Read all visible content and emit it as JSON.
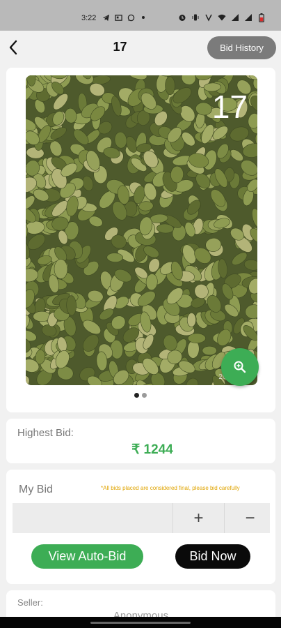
{
  "status_bar": {
    "time": "3:22",
    "left_icons": [
      "telegram-icon",
      "news-icon",
      "whatsapp-icon",
      "dot-icon"
    ],
    "right_icons": [
      "alarm-icon",
      "vibrate-icon",
      "volte-icon",
      "wifi-icon",
      "signal-icon",
      "signal-icon",
      "battery-icon"
    ]
  },
  "header": {
    "title": "17",
    "bid_history_label": "Bid History"
  },
  "product": {
    "lot_overlay": "17",
    "date_watermark": "2021-3-23",
    "image_count": 2,
    "active_image": 1
  },
  "highest_bid": {
    "label": "Highest Bid:",
    "value": "₹ 1244"
  },
  "my_bid": {
    "label": "My Bid",
    "note": "*All bids placed are considered final, please bid carefully",
    "input_value": "",
    "plus_label": "+",
    "minus_label": "−",
    "auto_bid_label": "View Auto-Bid",
    "bid_now_label": "Bid Now"
  },
  "seller": {
    "label": "Seller:",
    "value": "Anonymous"
  },
  "colors": {
    "accent_green": "#3dad55",
    "note_yellow": "#e0a400",
    "bid_now_black": "#0a0a0a"
  }
}
